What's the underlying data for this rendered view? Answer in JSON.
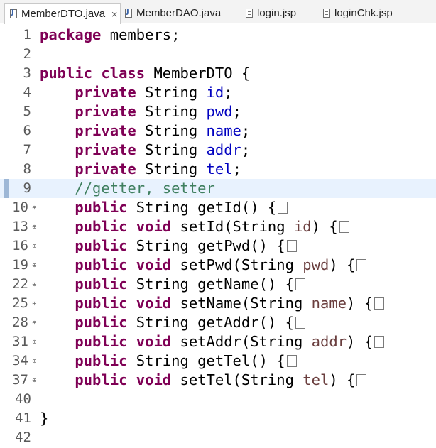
{
  "tabs": [
    {
      "label": "MemberDTO.java",
      "icon": "java-file-icon",
      "active": true,
      "closable": true
    },
    {
      "label": "MemberDAO.java",
      "icon": "java-file-icon",
      "active": false
    },
    {
      "label": "login.jsp",
      "icon": "jsp-file-icon",
      "active": false
    },
    {
      "label": "loginChk.jsp",
      "icon": "jsp-file-icon",
      "active": false
    }
  ],
  "editor": {
    "current_line": "9",
    "lines": [
      {
        "n": "1",
        "tokens": [
          {
            "t": "kw",
            "v": "package"
          },
          {
            "t": "plain",
            "v": " members;"
          }
        ]
      },
      {
        "n": "2",
        "tokens": []
      },
      {
        "n": "3",
        "tokens": [
          {
            "t": "kw",
            "v": "public"
          },
          {
            "t": "plain",
            "v": " "
          },
          {
            "t": "kw",
            "v": "class"
          },
          {
            "t": "plain",
            "v": " MemberDTO {"
          }
        ]
      },
      {
        "n": "4",
        "tokens": [
          {
            "t": "plain",
            "v": "    "
          },
          {
            "t": "kw",
            "v": "private"
          },
          {
            "t": "plain",
            "v": " String "
          },
          {
            "t": "fld",
            "v": "id"
          },
          {
            "t": "plain",
            "v": ";"
          }
        ]
      },
      {
        "n": "5",
        "tokens": [
          {
            "t": "plain",
            "v": "    "
          },
          {
            "t": "kw",
            "v": "private"
          },
          {
            "t": "plain",
            "v": " String "
          },
          {
            "t": "fld",
            "v": "pwd"
          },
          {
            "t": "plain",
            "v": ";"
          }
        ]
      },
      {
        "n": "6",
        "tokens": [
          {
            "t": "plain",
            "v": "    "
          },
          {
            "t": "kw",
            "v": "private"
          },
          {
            "t": "plain",
            "v": " String "
          },
          {
            "t": "fld",
            "v": "name"
          },
          {
            "t": "plain",
            "v": ";"
          }
        ]
      },
      {
        "n": "7",
        "tokens": [
          {
            "t": "plain",
            "v": "    "
          },
          {
            "t": "kw",
            "v": "private"
          },
          {
            "t": "plain",
            "v": " String "
          },
          {
            "t": "fld",
            "v": "addr"
          },
          {
            "t": "plain",
            "v": ";"
          }
        ]
      },
      {
        "n": "8",
        "tokens": [
          {
            "t": "plain",
            "v": "    "
          },
          {
            "t": "kw",
            "v": "private"
          },
          {
            "t": "plain",
            "v": " String "
          },
          {
            "t": "fld",
            "v": "tel"
          },
          {
            "t": "plain",
            "v": ";"
          }
        ]
      },
      {
        "n": "9",
        "tokens": [
          {
            "t": "plain",
            "v": "    "
          },
          {
            "t": "cmt",
            "v": "//getter, setter"
          }
        ]
      },
      {
        "n": "10",
        "folded": true,
        "tokens": [
          {
            "t": "plain",
            "v": "    "
          },
          {
            "t": "kw",
            "v": "public"
          },
          {
            "t": "plain",
            "v": " String getId() {"
          },
          {
            "t": "box",
            "v": ""
          }
        ]
      },
      {
        "n": "13",
        "folded": true,
        "tokens": [
          {
            "t": "plain",
            "v": "    "
          },
          {
            "t": "kw",
            "v": "public"
          },
          {
            "t": "plain",
            "v": " "
          },
          {
            "t": "kw",
            "v": "void"
          },
          {
            "t": "plain",
            "v": " setId(String "
          },
          {
            "t": "param",
            "v": "id"
          },
          {
            "t": "plain",
            "v": ") {"
          },
          {
            "t": "box",
            "v": ""
          }
        ]
      },
      {
        "n": "16",
        "folded": true,
        "tokens": [
          {
            "t": "plain",
            "v": "    "
          },
          {
            "t": "kw",
            "v": "public"
          },
          {
            "t": "plain",
            "v": " String getPwd() {"
          },
          {
            "t": "box",
            "v": ""
          }
        ]
      },
      {
        "n": "19",
        "folded": true,
        "tokens": [
          {
            "t": "plain",
            "v": "    "
          },
          {
            "t": "kw",
            "v": "public"
          },
          {
            "t": "plain",
            "v": " "
          },
          {
            "t": "kw",
            "v": "void"
          },
          {
            "t": "plain",
            "v": " setPwd(String "
          },
          {
            "t": "param",
            "v": "pwd"
          },
          {
            "t": "plain",
            "v": ") {"
          },
          {
            "t": "box",
            "v": ""
          }
        ]
      },
      {
        "n": "22",
        "folded": true,
        "tokens": [
          {
            "t": "plain",
            "v": "    "
          },
          {
            "t": "kw",
            "v": "public"
          },
          {
            "t": "plain",
            "v": " String getName() {"
          },
          {
            "t": "box",
            "v": ""
          }
        ]
      },
      {
        "n": "25",
        "folded": true,
        "tokens": [
          {
            "t": "plain",
            "v": "    "
          },
          {
            "t": "kw",
            "v": "public"
          },
          {
            "t": "plain",
            "v": " "
          },
          {
            "t": "kw",
            "v": "void"
          },
          {
            "t": "plain",
            "v": " setName(String "
          },
          {
            "t": "param",
            "v": "name"
          },
          {
            "t": "plain",
            "v": ") {"
          },
          {
            "t": "box",
            "v": ""
          }
        ]
      },
      {
        "n": "28",
        "folded": true,
        "tokens": [
          {
            "t": "plain",
            "v": "    "
          },
          {
            "t": "kw",
            "v": "public"
          },
          {
            "t": "plain",
            "v": " String getAddr() {"
          },
          {
            "t": "box",
            "v": ""
          }
        ]
      },
      {
        "n": "31",
        "folded": true,
        "tokens": [
          {
            "t": "plain",
            "v": "    "
          },
          {
            "t": "kw",
            "v": "public"
          },
          {
            "t": "plain",
            "v": " "
          },
          {
            "t": "kw",
            "v": "void"
          },
          {
            "t": "plain",
            "v": " setAddr(String "
          },
          {
            "t": "param",
            "v": "addr"
          },
          {
            "t": "plain",
            "v": ") {"
          },
          {
            "t": "box",
            "v": ""
          }
        ]
      },
      {
        "n": "34",
        "folded": true,
        "tokens": [
          {
            "t": "plain",
            "v": "    "
          },
          {
            "t": "kw",
            "v": "public"
          },
          {
            "t": "plain",
            "v": " String getTel() {"
          },
          {
            "t": "box",
            "v": ""
          }
        ]
      },
      {
        "n": "37",
        "folded": true,
        "tokens": [
          {
            "t": "plain",
            "v": "    "
          },
          {
            "t": "kw",
            "v": "public"
          },
          {
            "t": "plain",
            "v": " "
          },
          {
            "t": "kw",
            "v": "void"
          },
          {
            "t": "plain",
            "v": " setTel(String "
          },
          {
            "t": "param",
            "v": "tel"
          },
          {
            "t": "plain",
            "v": ") {"
          },
          {
            "t": "box",
            "v": ""
          }
        ]
      },
      {
        "n": "40",
        "tokens": []
      },
      {
        "n": "41",
        "tokens": [
          {
            "t": "plain",
            "v": "}"
          }
        ]
      },
      {
        "n": "42",
        "tokens": []
      }
    ]
  },
  "colors": {
    "keyword": "#7f0055",
    "field": "#0000c0",
    "parameter": "#6a3e3e",
    "comment": "#3f7f5f",
    "current_line_bg": "#e8f2fe"
  }
}
